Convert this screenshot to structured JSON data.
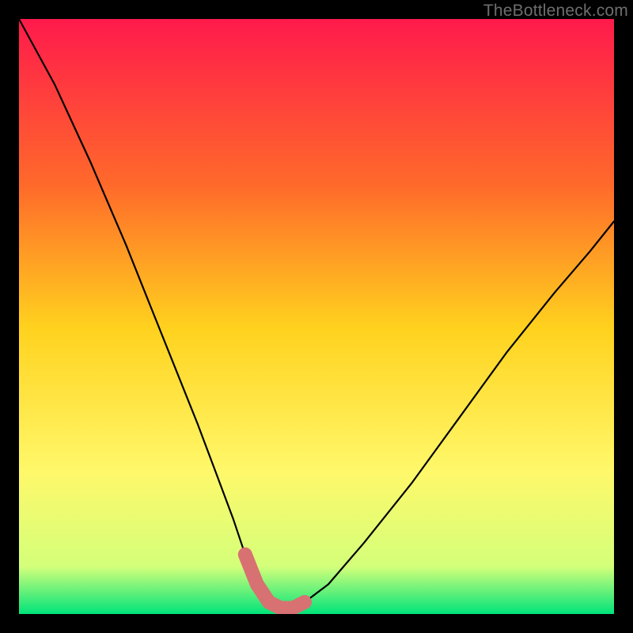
{
  "watermark": "TheBottleneck.com",
  "colors": {
    "frame": "#000000",
    "curve": "#000000",
    "marker": "#d87172",
    "grad_top": "#ff1a4c",
    "grad_mid1": "#ff6a2a",
    "grad_mid2": "#ffd21e",
    "grad_mid3": "#fff86a",
    "grad_mid4": "#d4ff7a",
    "grad_bot": "#00e47a"
  },
  "chart_data": {
    "type": "line",
    "title": "",
    "xlabel": "",
    "ylabel": "",
    "xlim": [
      0,
      100
    ],
    "ylim": [
      0,
      100
    ],
    "series": [
      {
        "name": "bottleneck-curve",
        "x": [
          0,
          6,
          12,
          18,
          22,
          26,
          30,
          33,
          36,
          38,
          40,
          42,
          44,
          46,
          48,
          52,
          58,
          66,
          74,
          82,
          90,
          96,
          100
        ],
        "values": [
          100,
          89,
          76,
          62,
          52,
          42,
          32,
          24,
          16,
          10,
          5,
          2,
          1,
          1,
          2,
          5,
          12,
          22,
          33,
          44,
          54,
          61,
          66
        ]
      }
    ],
    "markers": {
      "name": "highlight-segment",
      "x": [
        38,
        40,
        42,
        44,
        46,
        48
      ],
      "values": [
        10,
        5,
        2,
        1,
        1,
        2
      ]
    }
  }
}
